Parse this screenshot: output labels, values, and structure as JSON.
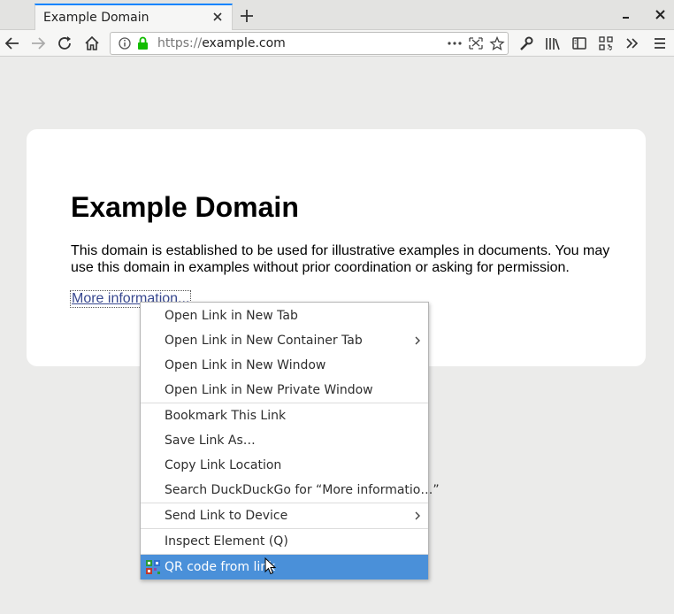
{
  "browser": {
    "tab_title": "Example Domain",
    "url_scheme": "https://",
    "url_host": "example.com"
  },
  "page": {
    "heading": "Example Domain",
    "paragraph": "This domain is established to be used for illustrative examples in documents. You may use this domain in examples without prior coordination or asking for permission.",
    "link_text": "More information..."
  },
  "context_menu": {
    "items": [
      {
        "label": "Open Link in New Tab"
      },
      {
        "label": "Open Link in New Container Tab"
      },
      {
        "label": "Open Link in New Window"
      },
      {
        "label": "Open Link in New Private Window"
      },
      {
        "label": "Bookmark This Link"
      },
      {
        "label": "Save Link As…"
      },
      {
        "label": "Copy Link Location"
      },
      {
        "label": "Search DuckDuckGo for “More informatio…”"
      },
      {
        "label": "Send Link to Device"
      },
      {
        "label": "Inspect Element (Q)"
      },
      {
        "label": "QR code from link"
      }
    ]
  },
  "colors": {
    "accent": "#0a84ff",
    "menu_highlight": "#4a90d9",
    "link": "#38488f",
    "lock_green": "#12bc00"
  },
  "icons": [
    "close-icon",
    "plus-icon",
    "minimize-icon",
    "window-close-icon",
    "back-arrow-icon",
    "forward-arrow-icon",
    "reload-icon",
    "home-icon",
    "info-icon",
    "lock-icon",
    "more-dots-icon",
    "screenshot-icon",
    "star-icon",
    "wrench-icon",
    "library-icon",
    "sidebar-icon",
    "qr-code-icon",
    "overflow-chevron-icon",
    "hamburger-menu-icon",
    "submenu-arrow-icon",
    "cursor-icon"
  ]
}
